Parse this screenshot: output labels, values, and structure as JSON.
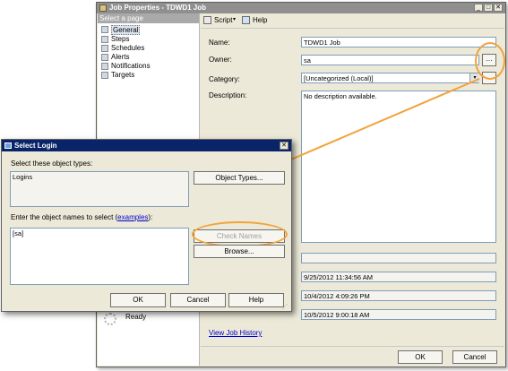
{
  "job_window": {
    "title": "Job Properties - TDWD1 Job",
    "select_page_header": "Select a page",
    "pages": [
      "General",
      "Steps",
      "Schedules",
      "Alerts",
      "Notifications",
      "Targets"
    ],
    "toolbar": {
      "script_label": "Script",
      "help_label": "Help"
    },
    "labels": {
      "name": "Name:",
      "owner": "Owner:",
      "category": "Category:",
      "description": "Description:"
    },
    "values": {
      "name": "TDWD1 Job",
      "owner": "sa",
      "category": "[Uncategorized (Local)]",
      "description": "No description available."
    },
    "dates": [
      "9/25/2012 11:34:56 AM",
      "10/4/2012 4:09:26 PM",
      "10/5/2012 9:00:18 AM"
    ],
    "status_text": "Ready",
    "view_history_link": "View Job History",
    "ok_label": "OK",
    "cancel_label": "Cancel"
  },
  "select_login": {
    "title": "Select Login",
    "object_types_label": "Select these object types:",
    "object_types_value": "Logins",
    "object_types_button": "Object Types...",
    "enter_names_prefix": "Enter the object names to select (",
    "examples_link": "examples",
    "enter_names_suffix": "):",
    "names_value": "[sa]",
    "check_names_button": "Check Names",
    "browse_button": "Browse...",
    "ok_label": "OK",
    "cancel_label": "Cancel",
    "help_label": "Help"
  },
  "colors": {
    "highlight": "#f2a33a",
    "dialog_title_bg": "#0a246a",
    "link": "#0000cc"
  }
}
